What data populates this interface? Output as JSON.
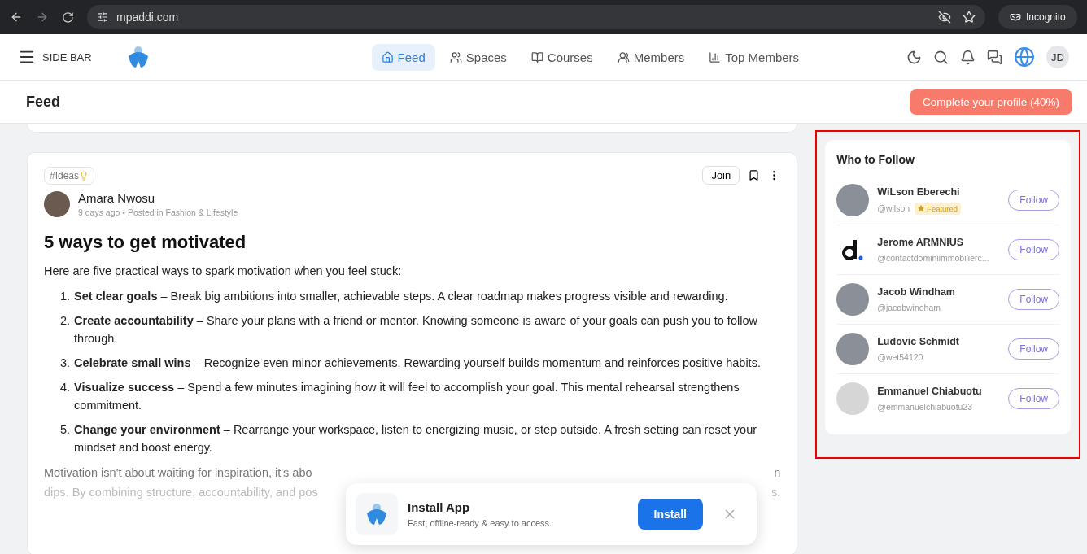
{
  "browser": {
    "url": "mpaddi.com",
    "profile": "Incognito"
  },
  "nav": {
    "sidebar_label": "SIDE BAR",
    "tabs": [
      {
        "label": "Feed",
        "selected": true,
        "kind": "home"
      },
      {
        "label": "Spaces",
        "selected": false,
        "kind": "spaces"
      },
      {
        "label": "Courses",
        "selected": false,
        "kind": "courses"
      },
      {
        "label": "Members",
        "selected": false,
        "kind": "members"
      },
      {
        "label": "Top Members",
        "selected": false,
        "kind": "chart"
      }
    ],
    "avatar_initials": "JD"
  },
  "page_header": {
    "title": "Feed",
    "profile_button": "Complete your profile (40%)"
  },
  "post": {
    "tag": "#Ideas",
    "join_button": "Join",
    "author": "Amara Nwosu",
    "meta": "9 days ago • Posted in Fashion & Lifestyle",
    "title": "5 ways to get motivated",
    "intro": "Here are five practical ways to spark motivation when you feel stuck:",
    "items": [
      {
        "number": "1.",
        "text": "**Set clear goals** – Break big ambitions into smaller, achievable steps. A clear roadmap makes progress visible and rewarding."
      },
      {
        "number": "2.",
        "text": "**Create accountability** – Share your plans with a friend or mentor. Knowing someone is aware of your goals can push you to follow through."
      },
      {
        "number": "3.",
        "text": "**Celebrate small wins** – Recognize even minor achievements. Rewarding yourself builds momentum and reinforces positive habits."
      },
      {
        "number": "4.",
        "text": "**Visualize success** – Spend a few minutes imagining how it will feel to accomplish your goal. This mental rehearsal strengthens commitment."
      },
      {
        "number": "5.",
        "text": "**Change your environment** – Rearrange your workspace, listen to energizing music, or step outside. A fresh setting can reset your mindset and boost energy."
      }
    ],
    "outro_lines": [
      {
        "left": "Motivation isn't about waiting for inspiration, it's abo",
        "right": "n"
      },
      {
        "left": "dips. By combining structure, accountability, and pos",
        "right": "s."
      }
    ]
  },
  "who_to_follow": {
    "title": "Who to Follow",
    "highlighted": true,
    "people": [
      {
        "name": "WiLson Eberechi",
        "handle": "@wilson",
        "badge": "Featured",
        "kind": "photo",
        "follow_button": "Follow"
      },
      {
        "name": "Jerome ARMNIUS",
        "handle": "@contactdominiimmobilierc...",
        "kind": "logo",
        "follow_button": "Follow"
      },
      {
        "name": "Jacob Windham",
        "handle": "@jacobwindham",
        "kind": "photo",
        "follow_button": "Follow"
      },
      {
        "name": "Ludovic Schmidt",
        "handle": "@wet54120",
        "kind": "photo",
        "follow_button": "Follow"
      },
      {
        "name": "Emmanuel Chiabuotu",
        "handle": "@emmanuelchiabuotu23",
        "kind": "default",
        "follow_button": "Follow"
      }
    ]
  },
  "install_popup": {
    "title": "Install App",
    "subtitle": "Fast, offline-ready & easy to access.",
    "button": "Install"
  }
}
